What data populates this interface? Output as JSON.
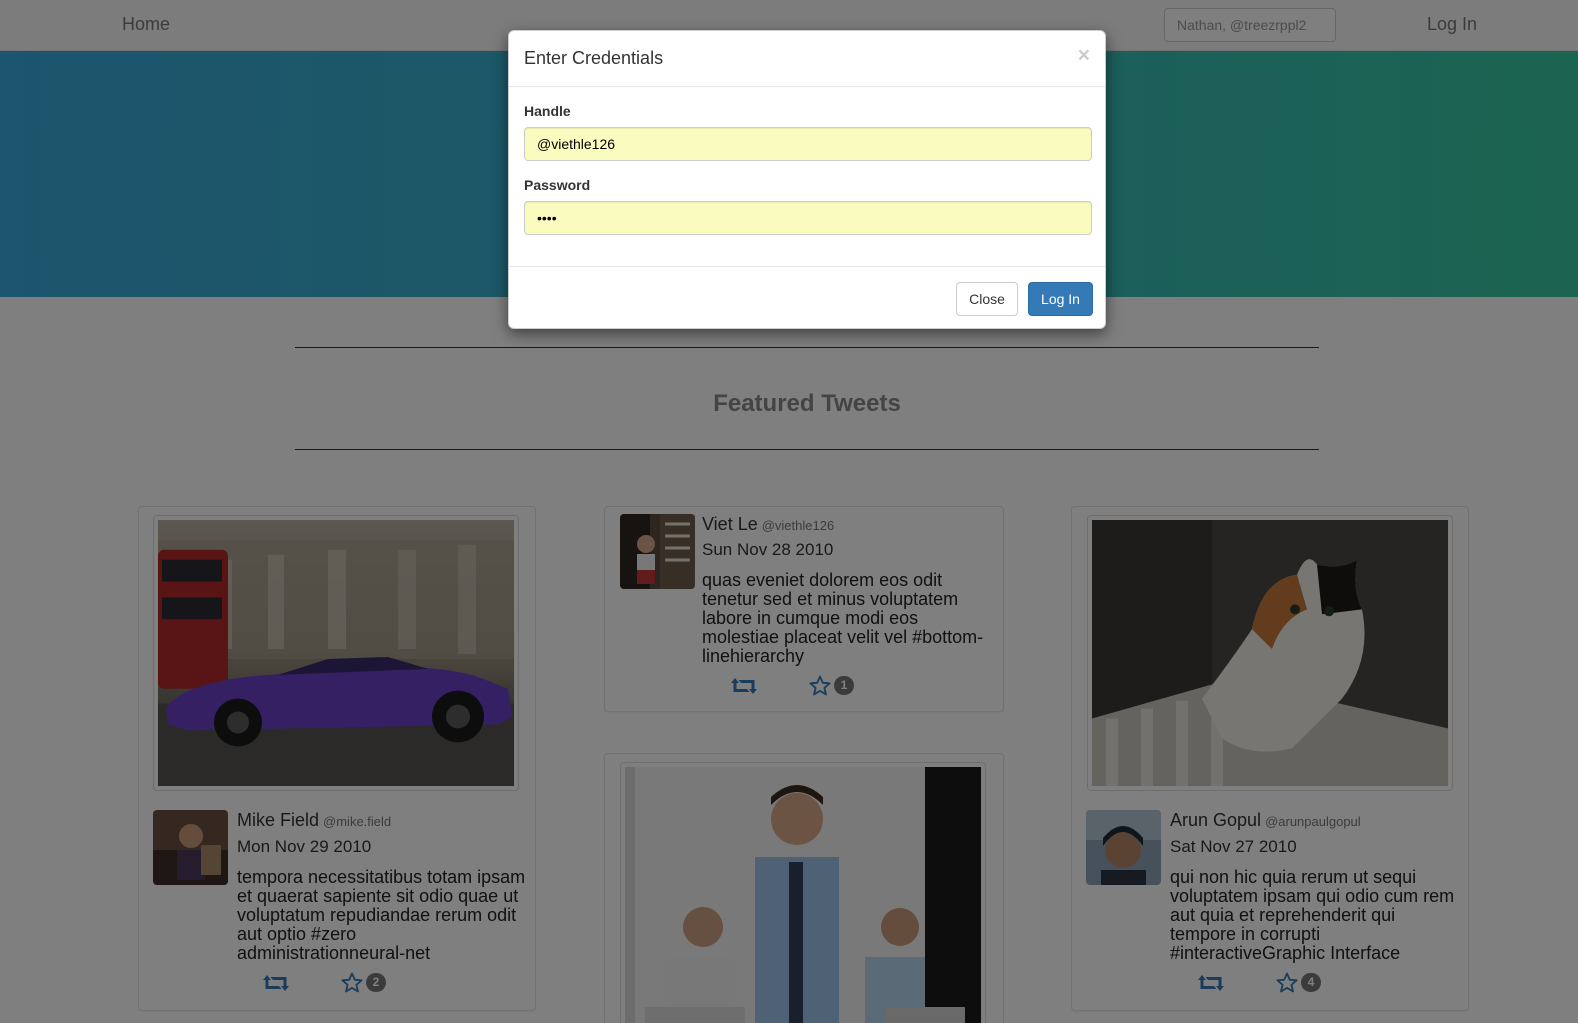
{
  "navbar": {
    "home_label": "Home",
    "search_value": "Nathan, @treezrppl2",
    "login_label": "Log In"
  },
  "section": {
    "title": "Featured Tweets"
  },
  "tweets": [
    {
      "name": "Mike Field",
      "handle": "@mike.field",
      "date": "Mon Nov 29 2010",
      "text": "tempora necessitatibus totam ipsam et quaerat sapiente sit odio quae ut voluptatum repudiandae rerum odit aut optio #zero administrationneural-net",
      "favorites": "2",
      "image_subject": "purple-sports-car"
    },
    {
      "name": "Viet Le",
      "handle": "@viethle126",
      "date": "Sun Nov 28 2010",
      "text": "quas eveniet dolorem eos odit tenetur sed et minus voluptatem labore in cumque modi eos molestiae placeat velit vel #bottom-linehierarchy",
      "favorites": "1"
    },
    {
      "name": "Arun Gopul",
      "handle": "@arunpaulgopul",
      "date": "Sat Nov 27 2010",
      "text": "qui non hic quia rerum ut sequi voluptatem ipsam qui odio cum rem aut quia et reprehenderit qui tempore in corrupti #interactiveGraphic Interface",
      "favorites": "4",
      "image_subject": "calico-cat"
    },
    {
      "image_subject": "office-workers"
    }
  ],
  "modal": {
    "title": "Enter Credentials",
    "close_x": "×",
    "handle_label": "Handle",
    "handle_value": "@viethle126",
    "password_label": "Password",
    "password_value": "••••",
    "close_button": "Close",
    "login_button": "Log In"
  },
  "colors": {
    "primary": "#337ab7",
    "hero_start": "#3aa9dc",
    "hero_end": "#38c9a1",
    "autofill": "#fafcbf",
    "badge": "#777777"
  }
}
